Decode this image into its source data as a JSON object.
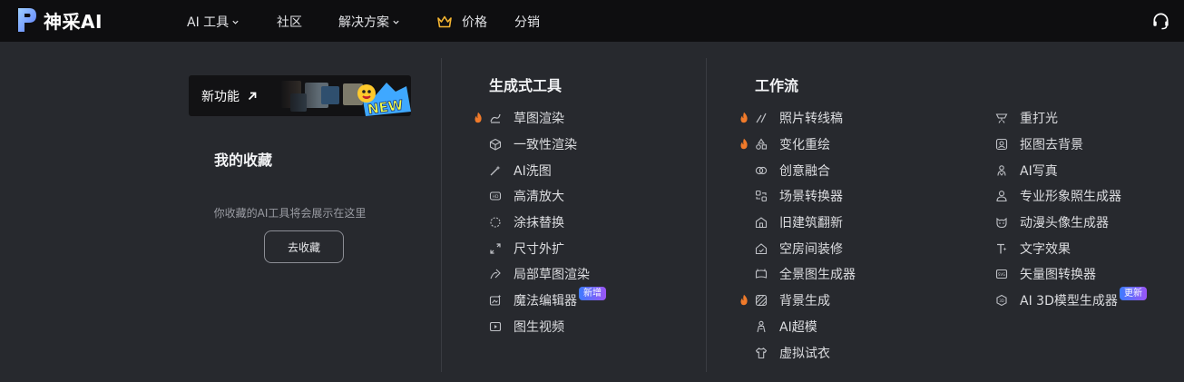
{
  "brand": {
    "name": "神采AI"
  },
  "nav": {
    "ai_tools": "AI 工具",
    "community": "社区",
    "solutions": "解决方案",
    "pricing": "价格",
    "affiliate": "分销"
  },
  "banner": {
    "label": "新功能",
    "badge": "NEW"
  },
  "favorites": {
    "title": "我的收藏",
    "empty_text": "你收藏的AI工具将会展示在这里",
    "button": "去收藏"
  },
  "gen_tools": {
    "title": "生成式工具",
    "items": [
      {
        "label": "草图渲染",
        "hot": true,
        "icon": "sketch-render-icon"
      },
      {
        "label": "一致性渲染",
        "hot": false,
        "icon": "cube-icon"
      },
      {
        "label": "AI洗图",
        "hot": false,
        "icon": "magic-wand-icon"
      },
      {
        "label": "高清放大",
        "hot": false,
        "icon": "hd-icon"
      },
      {
        "label": "涂抹替换",
        "hot": false,
        "icon": "brush-area-icon"
      },
      {
        "label": "尺寸外扩",
        "hot": false,
        "icon": "expand-icon"
      },
      {
        "label": "局部草图渲染",
        "hot": false,
        "icon": "partial-sketch-icon"
      },
      {
        "label": "魔法编辑器",
        "hot": false,
        "icon": "magic-editor-icon",
        "tag": "新增"
      },
      {
        "label": "图生视频",
        "hot": false,
        "icon": "image-to-video-icon"
      }
    ]
  },
  "workflow": {
    "title": "工作流",
    "col1": [
      {
        "label": "照片转线稿",
        "hot": true,
        "icon": "line-art-icon"
      },
      {
        "label": "变化重绘",
        "hot": true,
        "icon": "shapes-icon"
      },
      {
        "label": "创意融合",
        "hot": false,
        "icon": "blend-icon"
      },
      {
        "label": "场景转换器",
        "hot": false,
        "icon": "scene-convert-icon"
      },
      {
        "label": "旧建筑翻新",
        "hot": false,
        "icon": "building-icon"
      },
      {
        "label": "空房间装修",
        "hot": false,
        "icon": "house-icon"
      },
      {
        "label": "全景图生成器",
        "hot": false,
        "icon": "panorama-icon"
      },
      {
        "label": "背景生成",
        "hot": true,
        "icon": "background-icon"
      },
      {
        "label": "AI超模",
        "hot": false,
        "icon": "model-icon"
      },
      {
        "label": "虚拟试衣",
        "hot": false,
        "icon": "shirt-icon"
      }
    ],
    "col2": [
      {
        "label": "重打光",
        "hot": false,
        "icon": "relight-icon"
      },
      {
        "label": "抠图去背景",
        "hot": false,
        "icon": "remove-bg-icon"
      },
      {
        "label": "AI写真",
        "hot": false,
        "icon": "portrait-icon"
      },
      {
        "label": "专业形象照生成器",
        "hot": false,
        "icon": "headshot-icon"
      },
      {
        "label": "动漫头像生成器",
        "hot": false,
        "icon": "anime-icon"
      },
      {
        "label": "文字效果",
        "hot": false,
        "icon": "text-effect-icon"
      },
      {
        "label": "矢量图转换器",
        "hot": false,
        "icon": "svg-icon"
      },
      {
        "label": "AI 3D模型生成器",
        "hot": false,
        "icon": "3d-icon",
        "tag": "更新"
      }
    ]
  },
  "colors": {
    "fire": "#f07a2a",
    "tag_from": "#3d7bff",
    "tag_to": "#9b55f5"
  }
}
